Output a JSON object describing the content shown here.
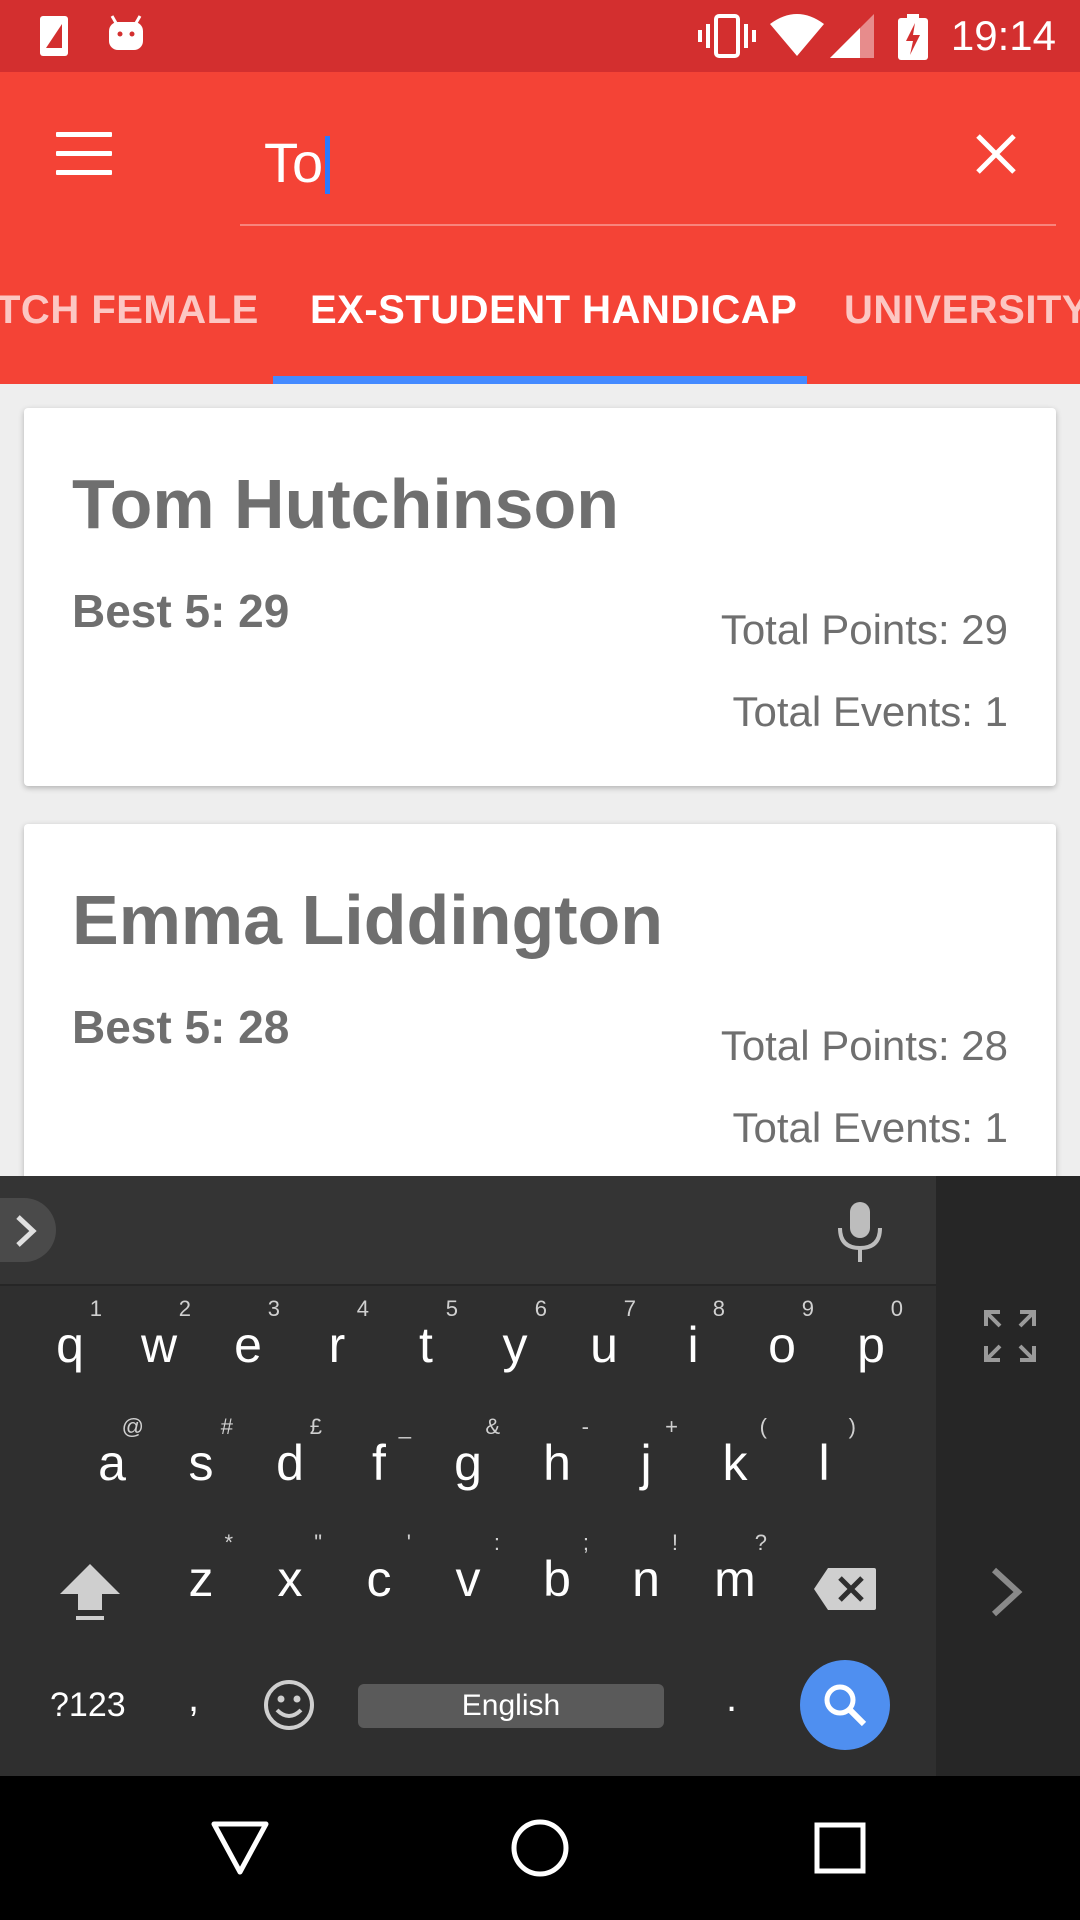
{
  "status_bar": {
    "time": "19:14"
  },
  "search": {
    "query": "To"
  },
  "tabs": [
    {
      "label": "TCH FEMALE"
    },
    {
      "label": "EX-STUDENT HANDICAP"
    },
    {
      "label": "UNIVERSITY"
    }
  ],
  "cards": [
    {
      "name": "Tom Hutchinson",
      "best5": "Best 5: 29",
      "total_points": "Total Points: 29",
      "total_events": "Total Events: 1"
    },
    {
      "name": "Emma Liddington",
      "best5": "Best 5: 28",
      "total_points": "Total Points: 28",
      "total_events": "Total Events: 1"
    }
  ],
  "keyboard": {
    "row1": [
      {
        "ch": "q",
        "hint": "1"
      },
      {
        "ch": "w",
        "hint": "2"
      },
      {
        "ch": "e",
        "hint": "3"
      },
      {
        "ch": "r",
        "hint": "4"
      },
      {
        "ch": "t",
        "hint": "5"
      },
      {
        "ch": "y",
        "hint": "6"
      },
      {
        "ch": "u",
        "hint": "7"
      },
      {
        "ch": "i",
        "hint": "8"
      },
      {
        "ch": "o",
        "hint": "9"
      },
      {
        "ch": "p",
        "hint": "0"
      }
    ],
    "row2": [
      {
        "ch": "a",
        "hint": "@"
      },
      {
        "ch": "s",
        "hint": "#"
      },
      {
        "ch": "d",
        "hint": "£"
      },
      {
        "ch": "f",
        "hint": "_"
      },
      {
        "ch": "g",
        "hint": "&"
      },
      {
        "ch": "h",
        "hint": "-"
      },
      {
        "ch": "j",
        "hint": "+"
      },
      {
        "ch": "k",
        "hint": "("
      },
      {
        "ch": "l",
        "hint": ")"
      }
    ],
    "row3": [
      {
        "ch": "z",
        "hint": "*"
      },
      {
        "ch": "x",
        "hint": "\""
      },
      {
        "ch": "c",
        "hint": "'"
      },
      {
        "ch": "v",
        "hint": ":"
      },
      {
        "ch": "b",
        "hint": ";"
      },
      {
        "ch": "n",
        "hint": "!"
      },
      {
        "ch": "m",
        "hint": "?"
      }
    ],
    "symbols_label": "?123",
    "comma": ",",
    "period": ".",
    "space_label": "English"
  },
  "icons": {
    "status": [
      "sim-icon",
      "android-icon",
      "vibrate-icon",
      "wifi-icon",
      "signal-icon",
      "battery-charging-icon"
    ],
    "nav": [
      "back-icon",
      "home-icon",
      "recents-icon"
    ]
  },
  "colors": {
    "status_bar": "#d32f2f",
    "app_bar": "#f44336",
    "tab_indicator": "#448aff",
    "search_key": "#4f8ff0",
    "keyboard_bg": "#2f2f2f"
  }
}
